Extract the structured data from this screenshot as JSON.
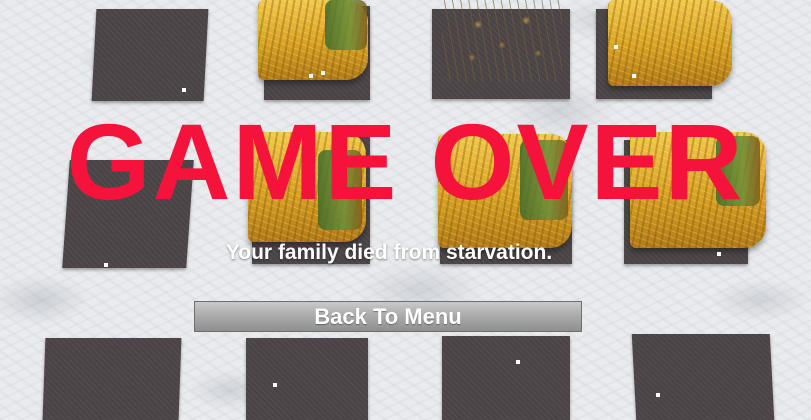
{
  "screen": {
    "title": "GAME OVER",
    "message": "Your family died from starvation.",
    "back_button_label": "Back To Menu"
  },
  "colors": {
    "title": "#f5133b",
    "message": "#ffffff",
    "button": "#a9a9a9"
  }
}
